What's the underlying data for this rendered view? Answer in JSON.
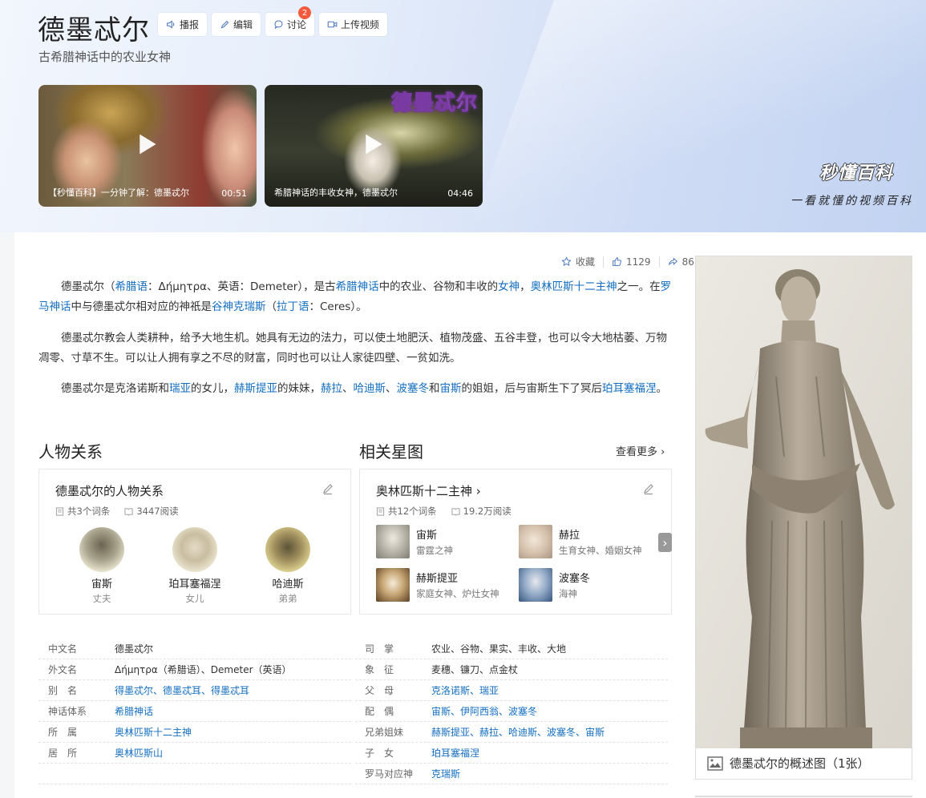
{
  "header": {
    "title": "德墨忒尔",
    "subtitle": "古希腊神话中的农业女神",
    "buttons": {
      "broadcast": "播报",
      "edit": "编辑",
      "discuss": "讨论",
      "discuss_badge": "2",
      "upload_video": "上传视频"
    },
    "videos": [
      {
        "caption": "【秒懂百科】一分钟了解：德墨忒尔",
        "duration": "00:51"
      },
      {
        "caption": "希腊神话的丰收女神，德墨忒尔",
        "duration": "04:46",
        "overlay_title": "德墨忒尔"
      }
    ],
    "brand": "秒懂百科",
    "slogan": "一看就懂的视频百科"
  },
  "toolbar": {
    "favorite": "收藏",
    "likes": "1129",
    "shares": "86"
  },
  "intro": {
    "p1": [
      {
        "t": "德墨忒尔（"
      },
      {
        "t": "希腊语",
        "link": true
      },
      {
        "t": "：Δήμητρα、英语：Demeter），是古"
      },
      {
        "t": "希腊神话",
        "link": true
      },
      {
        "t": "中的农业、谷物和丰收的"
      },
      {
        "t": "女神",
        "link": true
      },
      {
        "t": "，"
      },
      {
        "t": "奥林匹斯十二主神",
        "link": true
      },
      {
        "t": "之一。在"
      },
      {
        "t": "罗马神话",
        "link": true
      },
      {
        "t": "中与德墨忒尔相对应的神祇是"
      },
      {
        "t": "谷神克瑞斯",
        "link": true
      },
      {
        "t": "（"
      },
      {
        "t": "拉丁语",
        "link": true
      },
      {
        "t": "：Ceres）。"
      }
    ],
    "p2": [
      {
        "t": "德墨忒尔教会人类耕种，给予大地生机。她具有无边的法力，可以使土地肥沃、植物茂盛、五谷丰登，也可以令大地枯萎、万物凋零、寸草不生。可以让人拥有享之不尽的财富，同时也可以让人家徒四壁、一贫如洗。"
      }
    ],
    "p3": [
      {
        "t": "德墨忒尔是克洛诺斯和"
      },
      {
        "t": "瑞亚",
        "link": true
      },
      {
        "t": "的女儿，"
      },
      {
        "t": "赫斯提亚",
        "link": true
      },
      {
        "t": "的妹妹，"
      },
      {
        "t": "赫拉",
        "link": true
      },
      {
        "t": "、"
      },
      {
        "t": "哈迪斯",
        "link": true
      },
      {
        "t": "、"
      },
      {
        "t": "波塞冬",
        "link": true
      },
      {
        "t": "和"
      },
      {
        "t": "宙斯",
        "link": true
      },
      {
        "t": "的姐姐，后与宙斯生下了冥后"
      },
      {
        "t": "珀耳塞福涅",
        "link": true
      },
      {
        "t": "。"
      }
    ]
  },
  "relations": {
    "heading": "人物关系",
    "card_title": "德墨忒尔的人物关系",
    "entries": "共3个词条",
    "reads": "3447阅读",
    "people": [
      {
        "name": "宙斯",
        "role": "丈夫"
      },
      {
        "name": "珀耳塞福涅",
        "role": "女儿"
      },
      {
        "name": "哈迪斯",
        "role": "弟弟"
      }
    ]
  },
  "star_map": {
    "heading": "相关星图",
    "more": "查看更多",
    "card_title": "奥林匹斯十二主神",
    "entries": "共12个词条",
    "reads": "19.2万阅读",
    "items": [
      {
        "name": "宙斯",
        "desc": "雷霆之神"
      },
      {
        "name": "赫拉",
        "desc": "生育女神、婚姻女神"
      },
      {
        "name": "赫斯提亚",
        "desc": "家庭女神、炉灶女神"
      },
      {
        "name": "波塞冬",
        "desc": "海神"
      }
    ]
  },
  "info_left": [
    {
      "key": "中文名",
      "value": "德墨忒尔",
      "link": false
    },
    {
      "key": "外文名",
      "value": "Δήμητρα（希腊语）、Demeter（英语）",
      "link": false
    },
    {
      "key": "别　名",
      "value": "得墨忒尔、德墨忒耳、得墨忒耳",
      "link": true
    },
    {
      "key": "神话体系",
      "value": "希腊神话",
      "link": true
    },
    {
      "key": "所　属",
      "value": "奥林匹斯十二主神",
      "link": true
    },
    {
      "key": "居　所",
      "value": "奥林匹斯山",
      "link": true
    }
  ],
  "info_right": [
    {
      "key": "司　掌",
      "value": "农业、谷物、果实、丰收、大地",
      "link": false
    },
    {
      "key": "象　征",
      "value": "麦穗、镰刀、点金杖",
      "link": false
    },
    {
      "key": "父　母",
      "value": "克洛诺斯、瑞亚",
      "link": true
    },
    {
      "key": "配　偶",
      "value": "宙斯、伊阿西翁、波塞冬",
      "link": true
    },
    {
      "key": "兄弟姐妹",
      "value": "赫斯提亚、赫拉、哈迪斯、波塞冬、宙斯",
      "link": true
    },
    {
      "key": "子　女",
      "value": "珀耳塞福涅",
      "link": true
    },
    {
      "key": "罗马对应神",
      "value": "克瑞斯",
      "link": true
    }
  ],
  "overview_image": {
    "caption": "德墨忒尔的概述图（1张）"
  },
  "colors": {
    "link": "#136ec2",
    "badge": "#f55a3c",
    "banner": "#cfdcf5"
  }
}
